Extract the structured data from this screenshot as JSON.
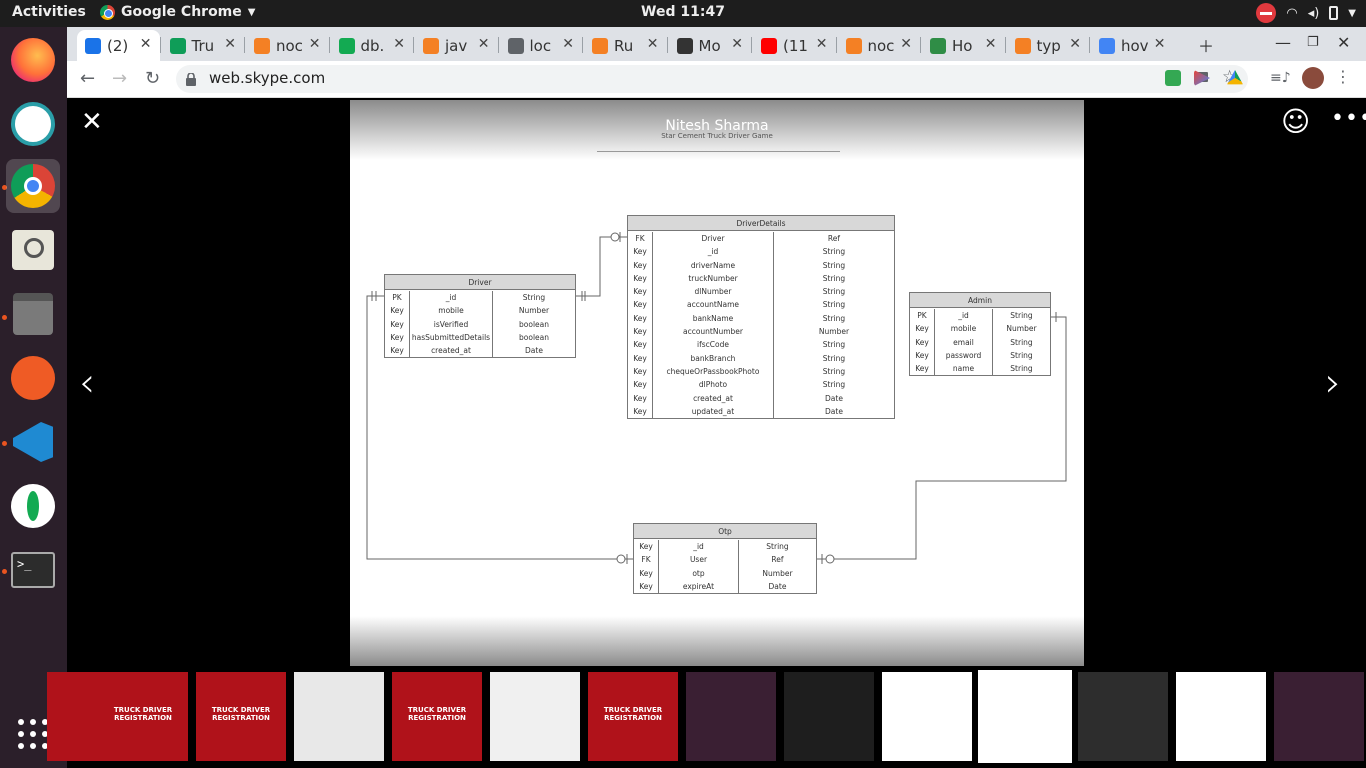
{
  "os": {
    "activities": "Activities",
    "app_name": "Google Chrome",
    "clock": "Wed 11:47"
  },
  "tabs": [
    {
      "label": "(2)",
      "color": "#1a73e8"
    },
    {
      "label": "Tru",
      "color": "#0f9d58"
    },
    {
      "label": "noc",
      "color": "#f48024"
    },
    {
      "label": "db.",
      "color": "#13aa52"
    },
    {
      "label": "jav",
      "color": "#f48024"
    },
    {
      "label": "loc",
      "color": "#5f6368"
    },
    {
      "label": "Ru",
      "color": "#f48024"
    },
    {
      "label": "Mo",
      "color": "#333333"
    },
    {
      "label": "(11",
      "color": "#ff0000"
    },
    {
      "label": "noc",
      "color": "#f48024"
    },
    {
      "label": "Ho",
      "color": "#2f8d46"
    },
    {
      "label": "typ",
      "color": "#f48024"
    },
    {
      "label": "hov",
      "color": "#4285f4"
    }
  ],
  "address_bar": {
    "url": "web.skype.com"
  },
  "image": {
    "sender": "Nitesh Sharma",
    "title": "Star Cement Truck Driver Game"
  },
  "entities": {
    "driver": {
      "name": "Driver",
      "rows": [
        [
          "PK",
          "_id",
          "String"
        ],
        [
          "Key",
          "mobile",
          "Number"
        ],
        [
          "Key",
          "isVerified",
          "boolean"
        ],
        [
          "Key",
          "hasSubmittedDetails",
          "boolean"
        ],
        [
          "Key",
          "created_at",
          "Date"
        ]
      ]
    },
    "driver_details": {
      "name": "DriverDetails",
      "rows": [
        [
          "FK",
          "Driver",
          "Ref"
        ],
        [
          "Key",
          "_id",
          "String"
        ],
        [
          "Key",
          "driverName",
          "String"
        ],
        [
          "Key",
          "truckNumber",
          "String"
        ],
        [
          "Key",
          "dlNumber",
          "String"
        ],
        [
          "Key",
          "accountName",
          "String"
        ],
        [
          "Key",
          "bankName",
          "String"
        ],
        [
          "Key",
          "accountNumber",
          "Number"
        ],
        [
          "Key",
          "ifscCode",
          "String"
        ],
        [
          "Key",
          "bankBranch",
          "String"
        ],
        [
          "Key",
          "chequeOrPassbookPhoto",
          "String"
        ],
        [
          "Key",
          "dlPhoto",
          "String"
        ],
        [
          "Key",
          "created_at",
          "Date"
        ],
        [
          "Key",
          "updated_at",
          "Date"
        ]
      ]
    },
    "admin": {
      "name": "Admin",
      "rows": [
        [
          "PK",
          "_id",
          "String"
        ],
        [
          "Key",
          "mobile",
          "Number"
        ],
        [
          "Key",
          "email",
          "String"
        ],
        [
          "Key",
          "password",
          "String"
        ],
        [
          "Key",
          "name",
          "String"
        ]
      ]
    },
    "otp": {
      "name": "Otp",
      "rows": [
        [
          "Key",
          "_id",
          "String"
        ],
        [
          "FK",
          "User",
          "Ref"
        ],
        [
          "Key",
          "otp",
          "Number"
        ],
        [
          "Key",
          "expireAt",
          "Date"
        ]
      ]
    }
  },
  "thumbnails": [
    {
      "caption": "",
      "bg": "#b0121a"
    },
    {
      "caption": "TRUCK DRIVER REGISTRATION",
      "bg": "#b0121a"
    },
    {
      "caption": "TRUCK DRIVER REGISTRATION",
      "bg": "#b0121a"
    },
    {
      "caption": "",
      "bg": "#e8e8e8"
    },
    {
      "caption": "TRUCK DRIVER REGISTRATION",
      "bg": "#b0121a"
    },
    {
      "caption": "",
      "bg": "#f0f0f0"
    },
    {
      "caption": "TRUCK DRIVER REGISTRATION",
      "bg": "#b0121a"
    },
    {
      "caption": "",
      "bg": "#3a1f33"
    },
    {
      "caption": "",
      "bg": "#1e1e1e"
    },
    {
      "caption": "",
      "bg": "#ffffff"
    },
    {
      "caption": "",
      "bg": "#ffffff"
    },
    {
      "caption": "",
      "bg": "#2d2d2d"
    },
    {
      "caption": "",
      "bg": "#ffffff"
    },
    {
      "caption": "",
      "bg": "#3a1f33"
    }
  ]
}
